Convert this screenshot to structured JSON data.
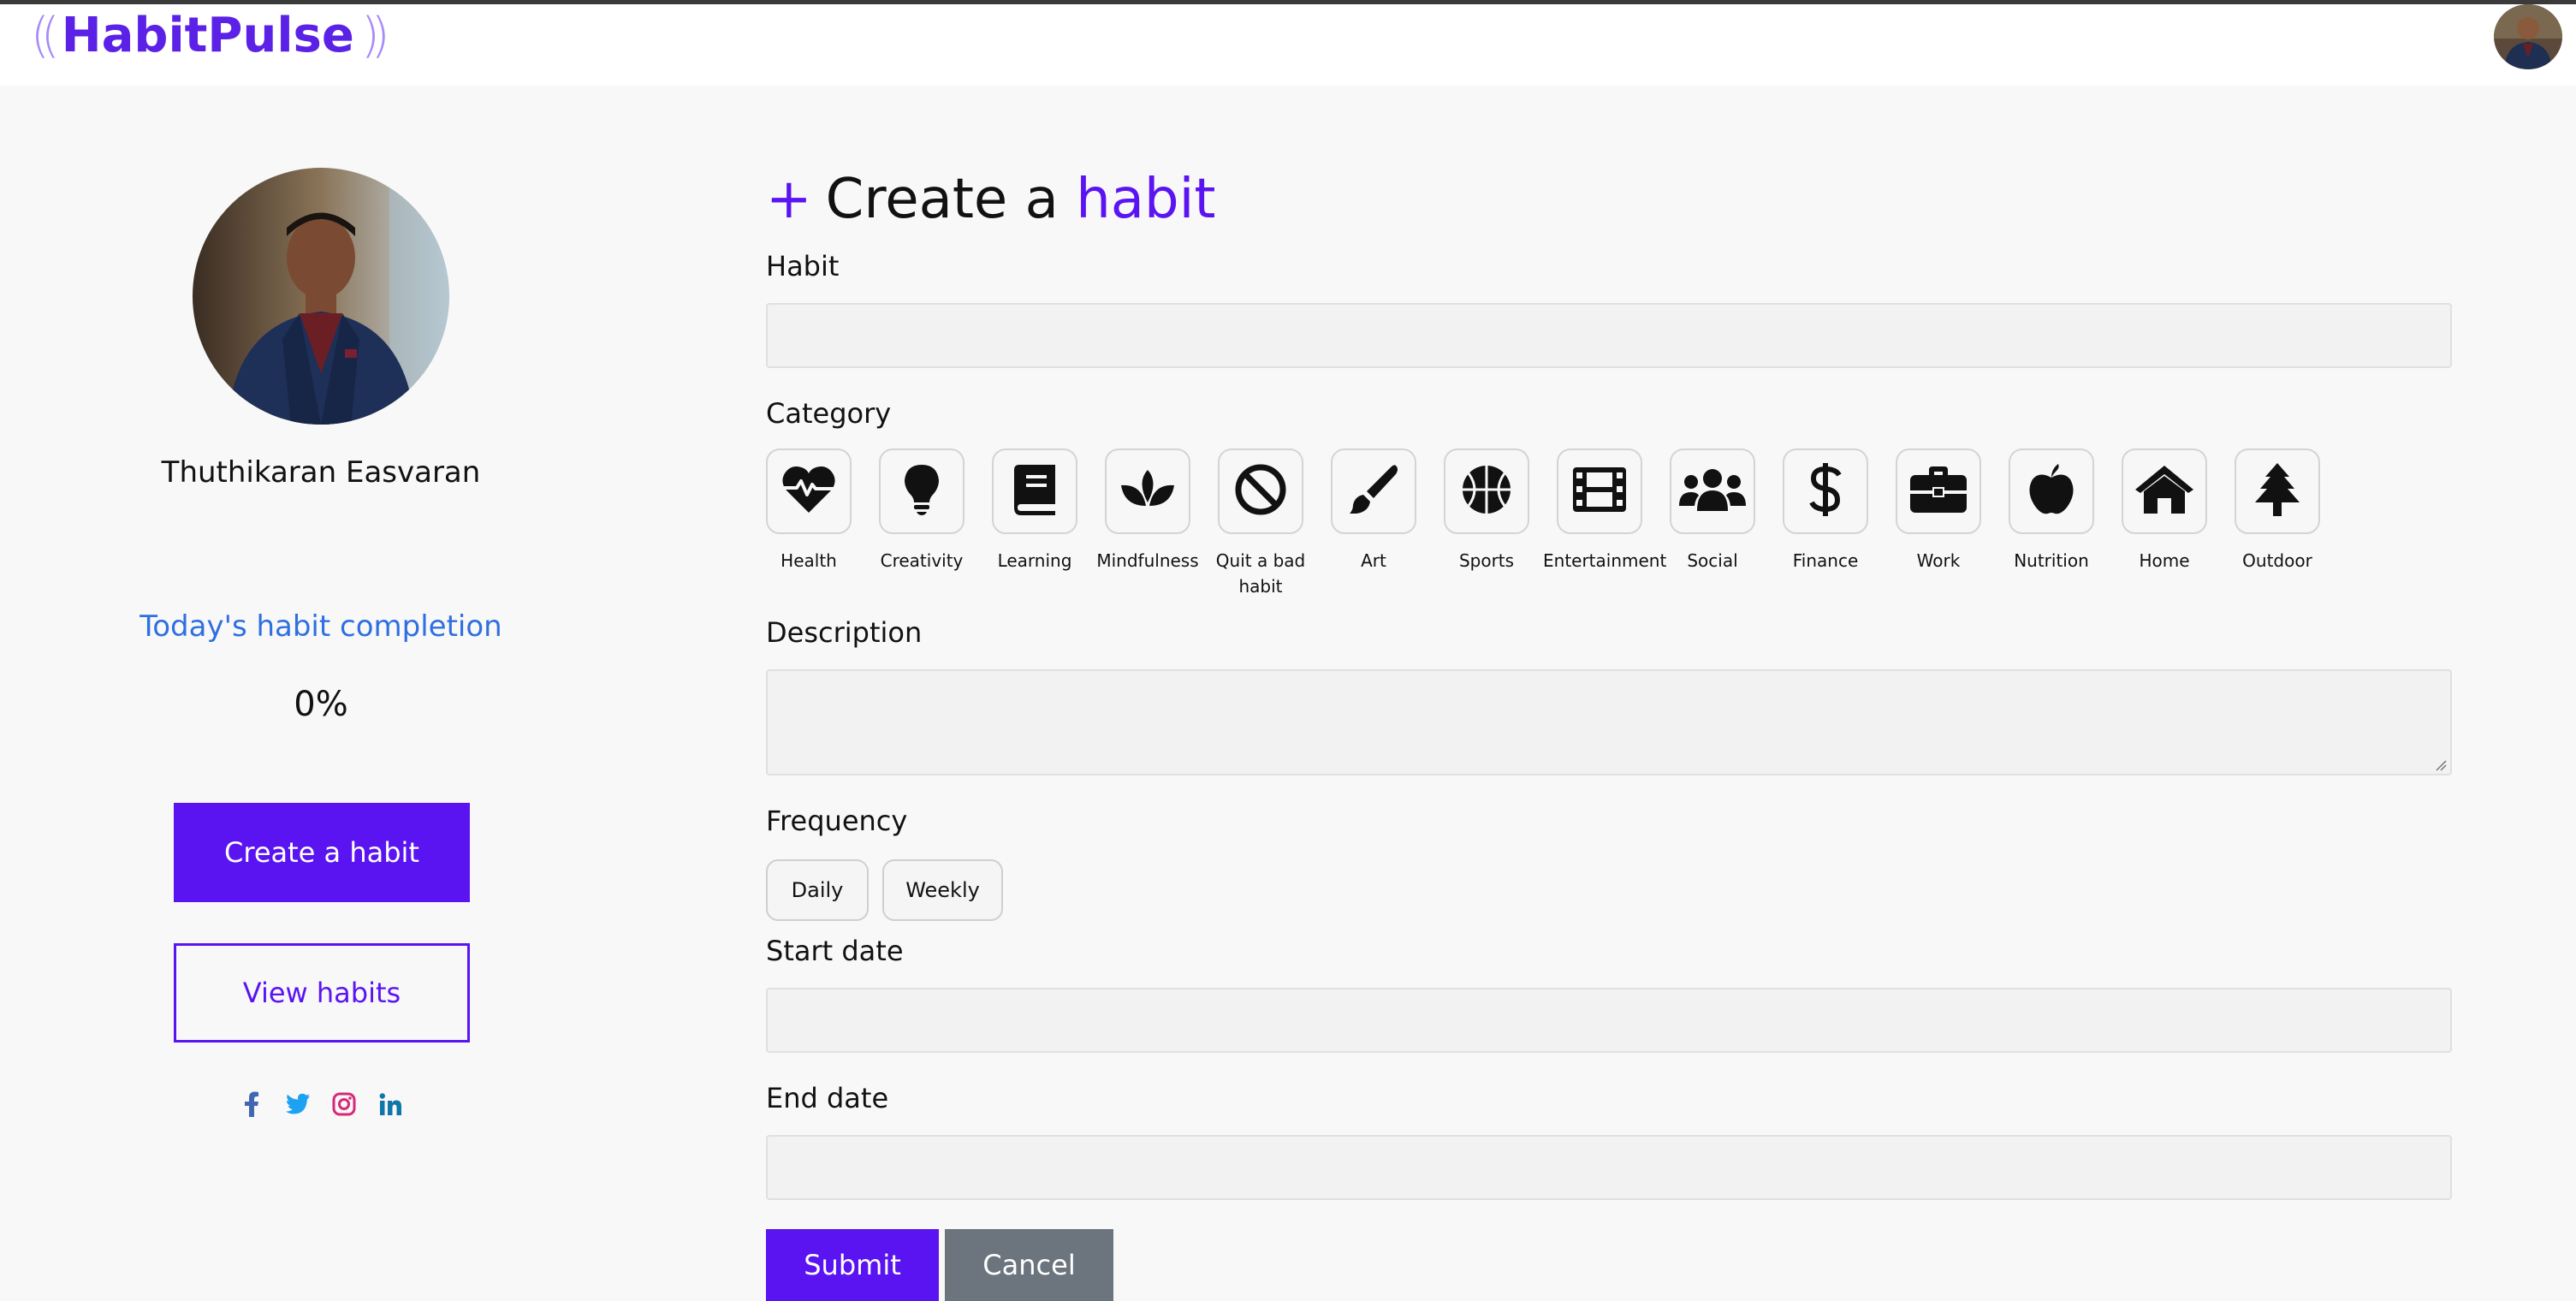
{
  "header": {
    "logo_text": "HabitPulse"
  },
  "sidebar": {
    "user_name": "Thuthikaran Easvaran",
    "completion_title": "Today's habit completion",
    "completion_value": "0%",
    "create_button": "Create a habit",
    "view_button": "View habits",
    "socials": [
      "facebook-icon",
      "twitter-icon",
      "instagram-icon",
      "linkedin-icon"
    ]
  },
  "form": {
    "title_prefix": "+",
    "title_main": "Create a",
    "title_accent": "habit",
    "habit_label": "Habit",
    "category_label": "Category",
    "categories": [
      {
        "label": "Health",
        "icon": "heart-pulse-icon"
      },
      {
        "label": "Creativity",
        "icon": "lightbulb-icon"
      },
      {
        "label": "Learning",
        "icon": "book-icon"
      },
      {
        "label": "Mindfulness",
        "icon": "lotus-icon"
      },
      {
        "label": "Quit a bad habit",
        "icon": "ban-icon"
      },
      {
        "label": "Art",
        "icon": "paintbrush-icon"
      },
      {
        "label": "Sports",
        "icon": "basketball-icon"
      },
      {
        "label": "Entertainment",
        "icon": "film-icon"
      },
      {
        "label": "Social",
        "icon": "users-icon"
      },
      {
        "label": "Finance",
        "icon": "dollar-icon"
      },
      {
        "label": "Work",
        "icon": "briefcase-icon"
      },
      {
        "label": "Nutrition",
        "icon": "apple-icon"
      },
      {
        "label": "Home",
        "icon": "home-icon"
      },
      {
        "label": "Outdoor",
        "icon": "tree-icon"
      }
    ],
    "description_label": "Description",
    "frequency_label": "Frequency",
    "frequency_options": [
      "Daily",
      "Weekly"
    ],
    "start_date_label": "Start date",
    "end_date_label": "End date",
    "submit_label": "Submit",
    "cancel_label": "Cancel"
  },
  "colors": {
    "accent": "#5a14f2",
    "completion_text": "#2f6fe0",
    "cancel_bg": "#6c757d"
  }
}
